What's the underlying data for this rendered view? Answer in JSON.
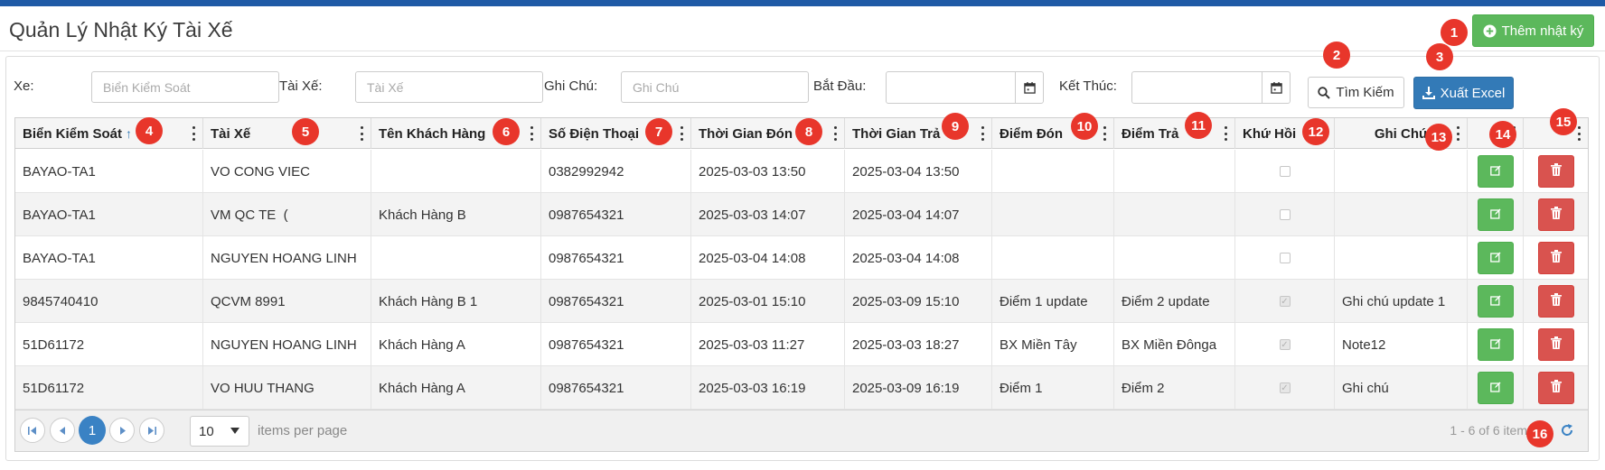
{
  "page": {
    "title": "Quản Lý Nhật Ký Tài Xế"
  },
  "actions": {
    "add_label": "Thêm nhật ký",
    "search_label": "Tìm Kiếm",
    "export_label": "Xuất Excel"
  },
  "filters": {
    "vehicle_label": "Xe:",
    "vehicle_placeholder": "Biển Kiểm Soát",
    "driver_label": "Tài Xế:",
    "driver_placeholder": "Tài Xế",
    "note_label": "Ghi Chú:",
    "note_placeholder": "Ghi Chú",
    "start_label": "Bắt Đầu:",
    "end_label": "Kết Thúc:"
  },
  "table": {
    "columns": [
      "Biển Kiểm Soát",
      "Tài Xế",
      "Tên Khách Hàng",
      "Số Điện Thoại",
      "Thời Gian Đón",
      "Thời Gian Trả",
      "Điểm Đón",
      "Điểm Trả",
      "Khứ Hồi",
      "Ghi Chú"
    ],
    "sort_arrow": "↑",
    "rows": [
      {
        "plate": "BAYAO-TA1",
        "driver": "VO CONG VIEC",
        "customer": "",
        "phone": "0382992942",
        "pickup_time": "2025-03-03 13:50",
        "dropoff_time": "2025-03-04 13:50",
        "pickup": "",
        "dropoff": "",
        "round_trip": false,
        "note": ""
      },
      {
        "plate": "BAYAO-TA1",
        "driver": "VM QC TE  (",
        "customer": "Khách Hàng B",
        "phone": "0987654321",
        "pickup_time": "2025-03-03 14:07",
        "dropoff_time": "2025-03-04 14:07",
        "pickup": "",
        "dropoff": "",
        "round_trip": false,
        "note": ""
      },
      {
        "plate": "BAYAO-TA1",
        "driver": "NGUYEN HOANG LINH",
        "customer": "",
        "phone": "0987654321",
        "pickup_time": "2025-03-04 14:08",
        "dropoff_time": "2025-03-04 14:08",
        "pickup": "",
        "dropoff": "",
        "round_trip": false,
        "note": ""
      },
      {
        "plate": "9845740410",
        "driver": "QCVM 8991",
        "customer": "Khách Hàng B 1",
        "phone": "0987654321",
        "pickup_time": "2025-03-01 15:10",
        "dropoff_time": "2025-03-09 15:10",
        "pickup": "Điểm 1 update",
        "dropoff": "Điểm 2 update",
        "round_trip": true,
        "note": "Ghi chú update 1"
      },
      {
        "plate": "51D61172",
        "driver": "NGUYEN HOANG LINH",
        "customer": "Khách Hàng A",
        "phone": "0987654321",
        "pickup_time": "2025-03-03 11:27",
        "dropoff_time": "2025-03-03 18:27",
        "pickup": "BX Miền Tây",
        "dropoff": "BX Miền Đônga",
        "round_trip": true,
        "note": "Note12"
      },
      {
        "plate": "51D61172",
        "driver": "VO HUU THANG",
        "customer": "Khách Hàng A",
        "phone": "0987654321",
        "pickup_time": "2025-03-03 16:19",
        "dropoff_time": "2025-03-09 16:19",
        "pickup": "Điểm 1",
        "dropoff": "Điểm 2",
        "round_trip": true,
        "note": "Ghi chú"
      }
    ]
  },
  "pager": {
    "current_page": "1",
    "page_size": "10",
    "per_page_label": "items per page",
    "count_text": "1 - 6 of 6 items"
  },
  "badges": [
    "1",
    "2",
    "3",
    "4",
    "5",
    "6",
    "7",
    "8",
    "9",
    "10",
    "11",
    "12",
    "13",
    "14",
    "15",
    "16"
  ],
  "colors": {
    "success": "#5cb85c",
    "danger": "#d9534f",
    "primary": "#337ab7",
    "badge": "#e8362b",
    "topbar": "#1f5aa6"
  }
}
